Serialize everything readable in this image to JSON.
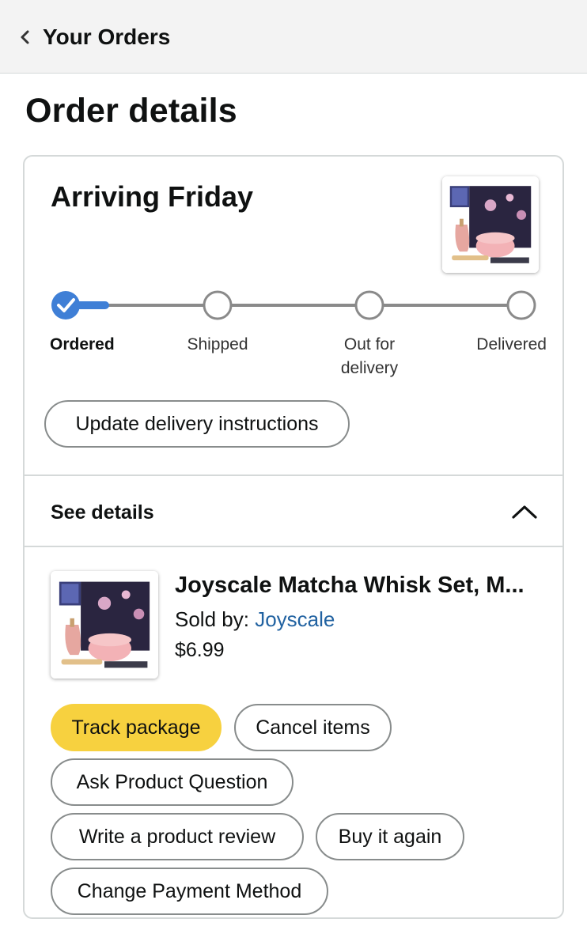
{
  "header": {
    "back_label": "Your Orders"
  },
  "page": {
    "title": "Order details"
  },
  "shipment": {
    "status": "Arriving Friday",
    "progress_fraction": 0.1,
    "steps": [
      {
        "label": "Ordered",
        "state": "done"
      },
      {
        "label": "Shipped",
        "state": "pending"
      },
      {
        "label": "Out for delivery",
        "state": "pending"
      },
      {
        "label": "Delivered",
        "state": "pending"
      }
    ],
    "update_instructions_label": "Update delivery instructions"
  },
  "details": {
    "toggle_label": "See details",
    "expanded": true
  },
  "item": {
    "title": "Joyscale Matcha Whisk Set, M...",
    "sold_by_prefix": "Sold by:",
    "seller": "Joyscale",
    "price": "$6.99"
  },
  "actions": {
    "track": "Track package",
    "cancel": "Cancel items",
    "ask": "Ask Product Question",
    "review": "Write a product review",
    "buy_again": "Buy it again",
    "change_payment": "Change Payment Method"
  },
  "colors": {
    "accent_blue": "#3f7fd6",
    "track_yellow": "#f7d13f",
    "link_blue": "#2162a1",
    "pending_gray": "#8a8a8a"
  }
}
